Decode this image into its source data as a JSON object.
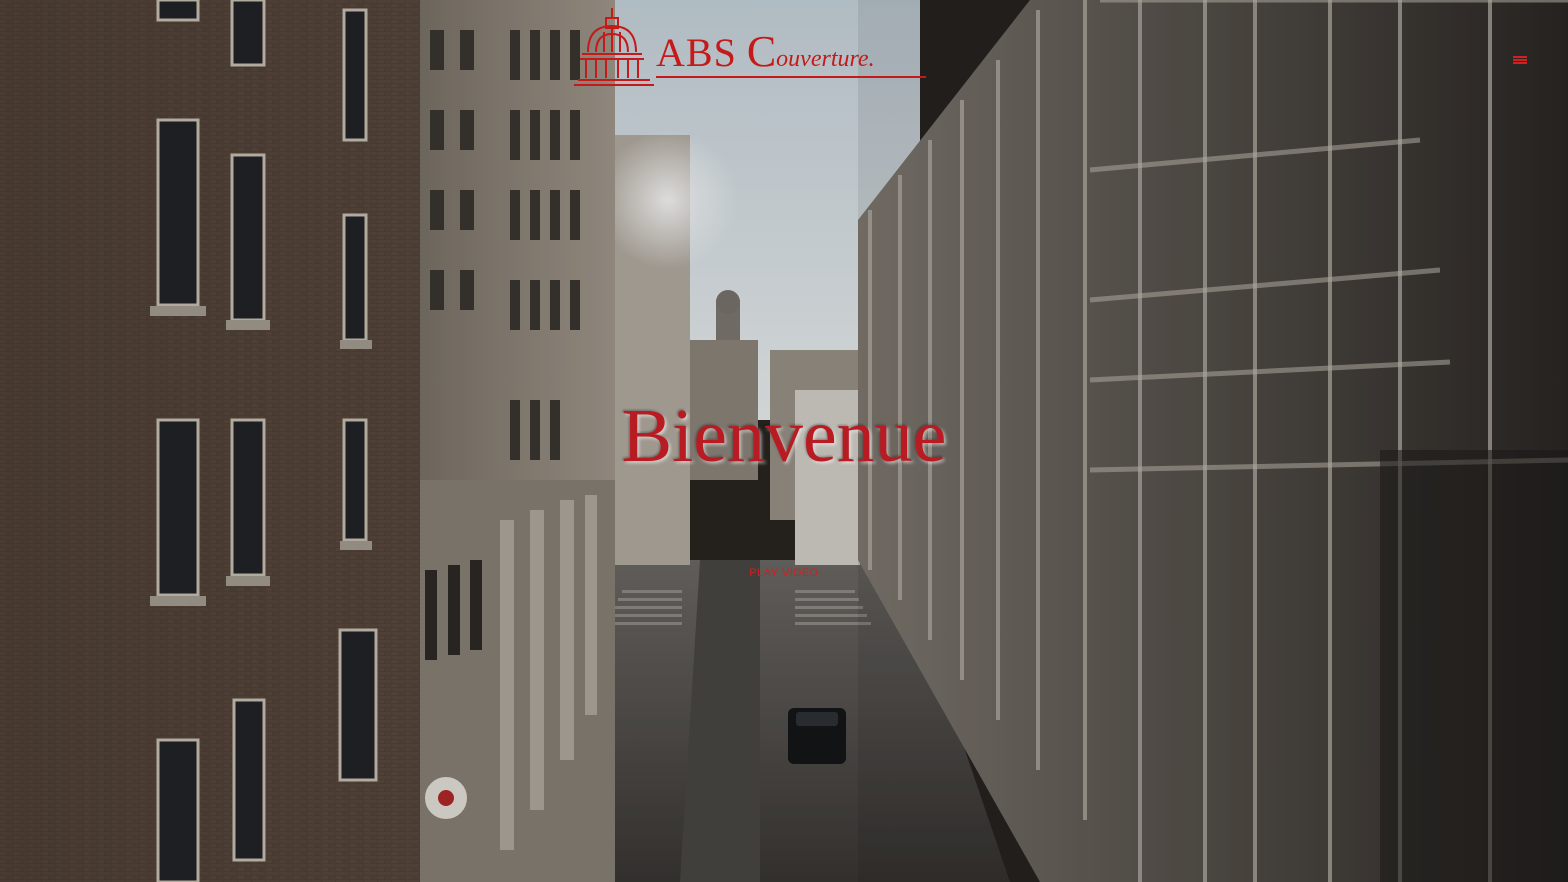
{
  "header": {
    "logo": {
      "brand_abs": "ABS",
      "brand_c": "C",
      "brand_rest": "ouverture.",
      "icon": "capitol-dome-icon"
    },
    "menu_icon": "hamburger-menu-icon"
  },
  "hero": {
    "title": "Bienvenue",
    "play_label": "PLAY VIDEO",
    "background": "city-street-aerial-photo"
  },
  "colors": {
    "brand_red": "#c41a1a",
    "title_red": "#b81c22",
    "link_red": "#d21f1f"
  }
}
